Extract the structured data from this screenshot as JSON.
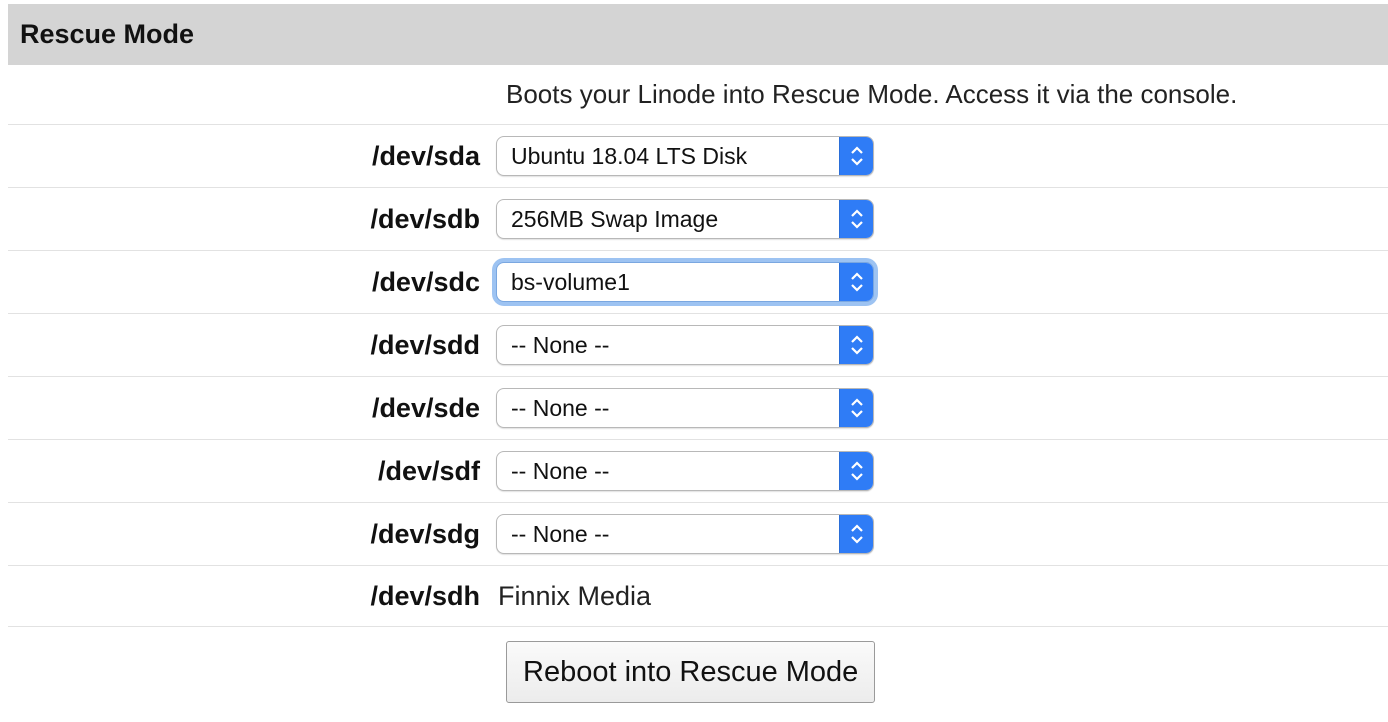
{
  "header": {
    "title": "Rescue Mode"
  },
  "description": "Boots your Linode into Rescue Mode. Access it via the console.",
  "devices": [
    {
      "label": "/dev/sda",
      "value": "Ubuntu 18.04 LTS Disk"
    },
    {
      "label": "/dev/sdb",
      "value": "256MB Swap Image"
    },
    {
      "label": "/dev/sdc",
      "value": "bs-volume1"
    },
    {
      "label": "/dev/sdd",
      "value": "-- None --"
    },
    {
      "label": "/dev/sde",
      "value": "-- None --"
    },
    {
      "label": "/dev/sdf",
      "value": "-- None --"
    },
    {
      "label": "/dev/sdg",
      "value": "-- None --"
    }
  ],
  "finnix": {
    "label": "/dev/sdh",
    "value": "Finnix Media"
  },
  "action": {
    "label": "Reboot into Rescue Mode"
  },
  "icons": {
    "select_stepper": "chevron-up-down-icon"
  },
  "colors": {
    "header_bg": "#d4d4d4",
    "stepper_blue": "#2f7cf6",
    "focus_ring": "#9dc3f2"
  }
}
